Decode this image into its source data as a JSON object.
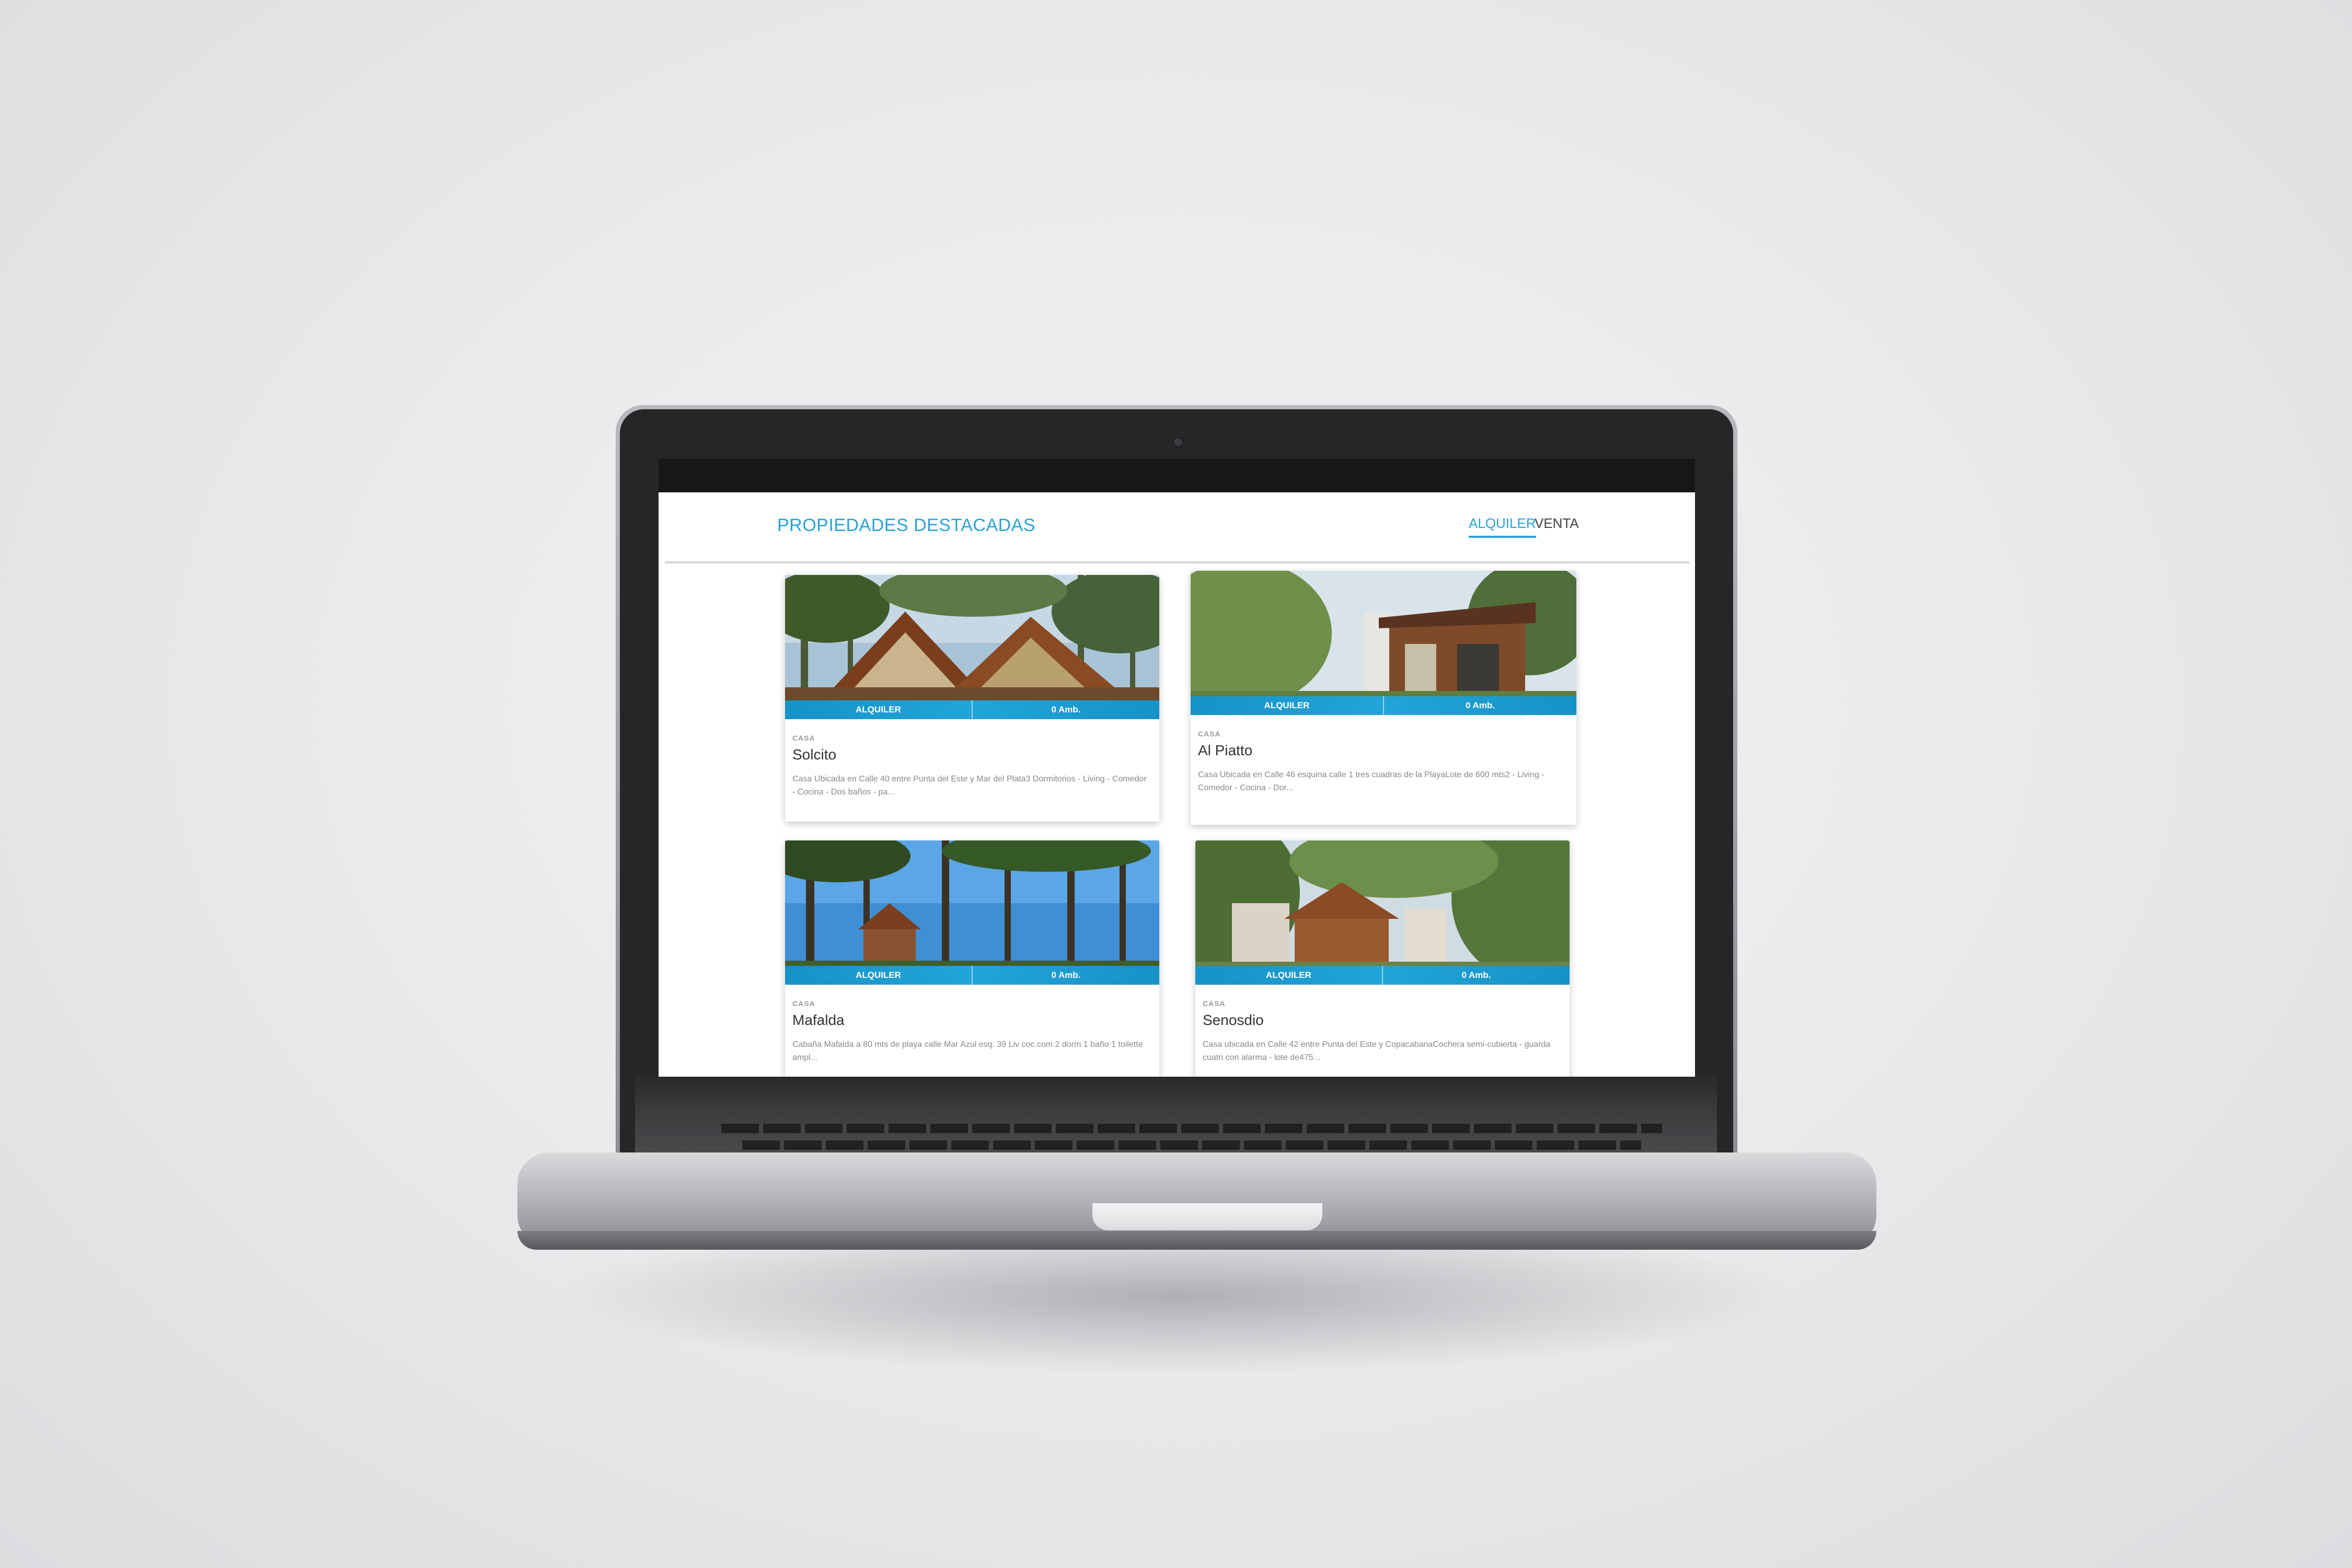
{
  "page": {
    "title": "PROPIEDADES DESTACADAS",
    "tabs": [
      {
        "label": "ALQUILER",
        "active": true
      },
      {
        "label": "VENTA",
        "active": false
      }
    ]
  },
  "colors": {
    "accent": "#2aa3d4",
    "bar": "#1a9ad0"
  },
  "properties": [
    {
      "operation": "ALQUILER",
      "rooms": "0 Amb.",
      "type": "CASA",
      "name": "Solcito",
      "description": "Casa Ubicada en Calle 40 entre Punta del Este y Mar del Plata3 Dormitorios - Living - Comedor - Cocina - Dos baños - pa..."
    },
    {
      "operation": "ALQUILER",
      "rooms": "0 Amb.",
      "type": "CASA",
      "name": "Al Piatto",
      "description": "Casa Ubicada en Calle 46 esquina calle 1 tres cuadras de la PlayaLote de 600 mts2  - Living - Comedor - Cocina - Dor..."
    },
    {
      "operation": "ALQUILER",
      "rooms": "0 Amb.",
      "type": "CASA",
      "name": "Mafalda",
      "description": "Cabaña Mafalda a 80 mts de playa calle Mar Azul esq. 39 Liv coc.com 2 dorm 1 baño 1 toilette ampl..."
    },
    {
      "operation": "ALQUILER",
      "rooms": "0 Amb.",
      "type": "CASA",
      "name": "Senosdio",
      "description": "Casa ubicada en Calle 42 entre Punta del Este y CopacabanaCochera semi-cubierta - guarda cuatri con alarma - lote de475..."
    }
  ]
}
